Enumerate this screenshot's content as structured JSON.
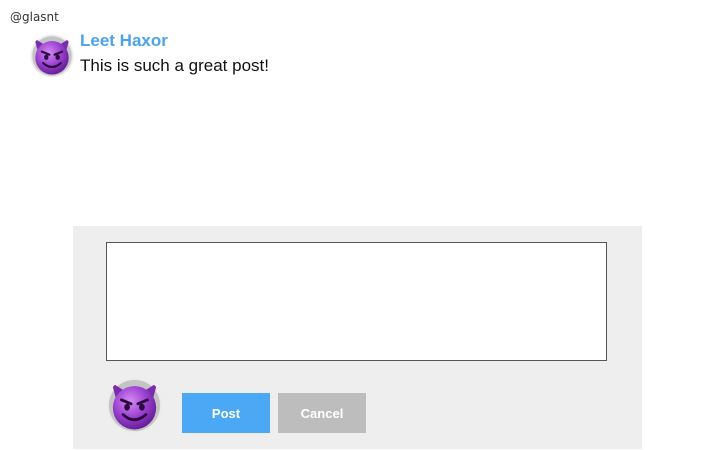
{
  "user": {
    "handle": "@glasnt"
  },
  "comment": {
    "author": "Leet Haxor",
    "text": "This is such a great post!",
    "avatar_icon": "smiling-devil-icon"
  },
  "composer": {
    "input_value": "",
    "avatar_icon": "smiling-devil-icon",
    "post_label": "Post",
    "cancel_label": "Cancel"
  },
  "colors": {
    "author": "#4aa3f0",
    "post_button": "#4aa8f5",
    "cancel_button": "#bdbdbd",
    "composer_background": "#eeeeee",
    "avatar_purple": "#9b3fd1"
  }
}
